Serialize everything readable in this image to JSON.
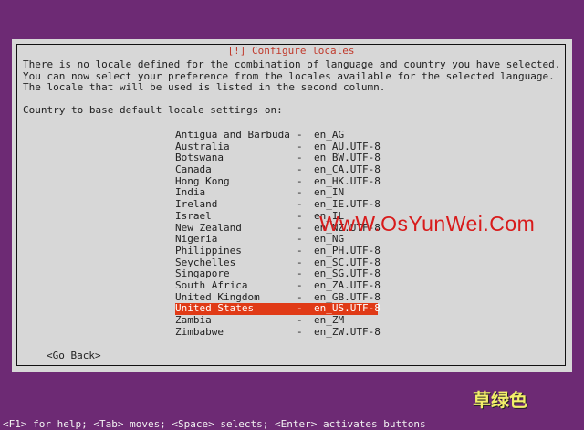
{
  "dialog": {
    "title": "[!] Configure locales",
    "description": "There is no locale defined for the combination of language and country you have selected.\nYou can now select your preference from the locales available for the selected language.\nThe locale that will be used is listed in the second column.",
    "prompt": "Country to base default locale settings on:",
    "locales": [
      {
        "country": "Antigua and Barbuda",
        "dash": "-",
        "code": "en_AG"
      },
      {
        "country": "Australia",
        "dash": "-",
        "code": "en_AU.UTF-8"
      },
      {
        "country": "Botswana",
        "dash": "-",
        "code": "en_BW.UTF-8"
      },
      {
        "country": "Canada",
        "dash": "-",
        "code": "en_CA.UTF-8"
      },
      {
        "country": "Hong Kong",
        "dash": "-",
        "code": "en_HK.UTF-8"
      },
      {
        "country": "India",
        "dash": "-",
        "code": "en_IN"
      },
      {
        "country": "Ireland",
        "dash": "-",
        "code": "en_IE.UTF-8"
      },
      {
        "country": "Israel",
        "dash": "-",
        "code": "en_IL"
      },
      {
        "country": "New Zealand",
        "dash": "-",
        "code": "en_NZ.UTF-8"
      },
      {
        "country": "Nigeria",
        "dash": "-",
        "code": "en_NG"
      },
      {
        "country": "Philippines",
        "dash": "-",
        "code": "en_PH.UTF-8"
      },
      {
        "country": "Seychelles",
        "dash": "-",
        "code": "en_SC.UTF-8"
      },
      {
        "country": "Singapore",
        "dash": "-",
        "code": "en_SG.UTF-8"
      },
      {
        "country": "South Africa",
        "dash": "-",
        "code": "en_ZA.UTF-8"
      },
      {
        "country": "United Kingdom",
        "dash": "-",
        "code": "en_GB.UTF-8"
      },
      {
        "country": "United States",
        "dash": "-",
        "code": "en_US.UTF-8"
      },
      {
        "country": "Zambia",
        "dash": "-",
        "code": "en_ZM"
      },
      {
        "country": "Zimbabwe",
        "dash": "-",
        "code": "en_ZW.UTF-8"
      }
    ],
    "selected_index": 15,
    "go_back_label": "<Go Back>"
  },
  "watermark": {
    "site": "WwW.OsYunWei.Com",
    "caption": "草绿色"
  },
  "statusbar": {
    "help": "<F1> for help; <Tab> moves; <Space> selects; <Enter> activates buttons"
  },
  "colors": {
    "background": "#6d2a74",
    "dialog": "#d7d7d7",
    "selection": "#e03a16",
    "title": "#c0392b"
  }
}
